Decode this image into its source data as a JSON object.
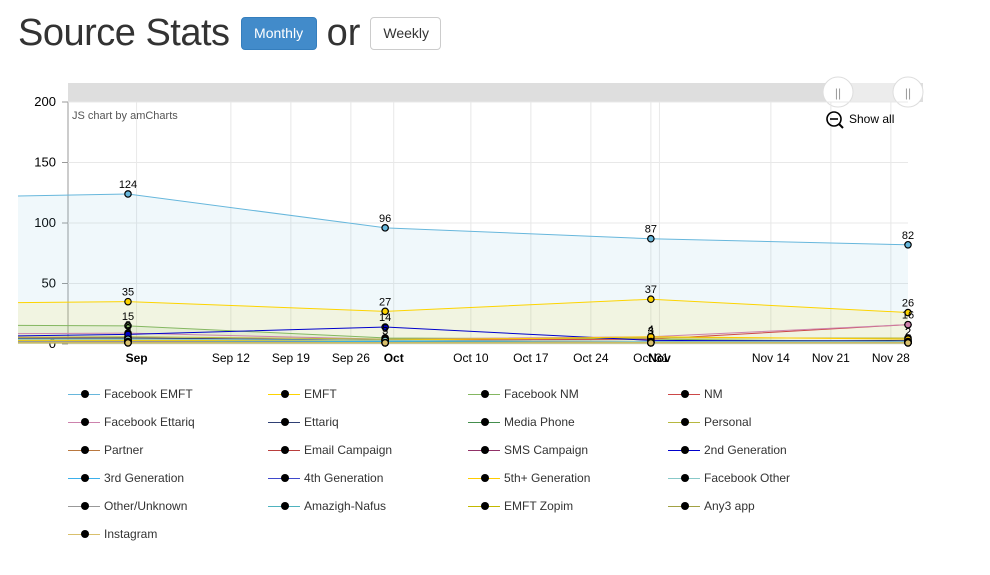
{
  "page": {
    "title": "Source Stats",
    "or_text": "or",
    "monthly_label": "Monthly",
    "weekly_label": "Weekly"
  },
  "chart_ui": {
    "credit": "JS chart by amCharts",
    "show_all": "Show all",
    "scroll_handle_glyph": "||"
  },
  "colors": {
    "primary_button": "#428bca",
    "grid": "#e8e8e8",
    "scrollbar": "#dedede"
  },
  "chart_data": {
    "type": "line",
    "ylim": [
      0,
      200
    ],
    "yticks": [
      0,
      50,
      100,
      150,
      200
    ],
    "xlim": [
      "2015-08-24",
      "2015-11-30"
    ],
    "xticks": [
      {
        "date": "2015-09-01",
        "label": "Sep",
        "bold": true
      },
      {
        "date": "2015-09-12",
        "label": "Sep 12"
      },
      {
        "date": "2015-09-19",
        "label": "Sep 19"
      },
      {
        "date": "2015-09-26",
        "label": "Sep 26"
      },
      {
        "date": "2015-10-01",
        "label": "Oct",
        "bold": true
      },
      {
        "date": "2015-10-10",
        "label": "Oct 10"
      },
      {
        "date": "2015-10-17",
        "label": "Oct 17"
      },
      {
        "date": "2015-10-24",
        "label": "Oct 24"
      },
      {
        "date": "2015-10-31",
        "label": "Oct 31"
      },
      {
        "date": "2015-11-01",
        "label": "Nov",
        "bold": true
      },
      {
        "date": "2015-11-14",
        "label": "Nov 14"
      },
      {
        "date": "2015-11-21",
        "label": "Nov 21"
      },
      {
        "date": "2015-11-28",
        "label": "Nov 28"
      }
    ],
    "x": [
      "2015-08-01",
      "2015-08-31",
      "2015-09-30",
      "2015-10-31",
      "2015-11-30"
    ],
    "grid": true,
    "legend_position": "bottom",
    "series": [
      {
        "name": "Facebook EMFT",
        "color": "#67b7dc",
        "fill": true,
        "values": [
          120,
          124,
          96,
          87,
          82
        ],
        "labels": true
      },
      {
        "name": "EMFT",
        "color": "#fdd400",
        "fill": true,
        "values": [
          33,
          35,
          27,
          37,
          26
        ],
        "labels": true
      },
      {
        "name": "Facebook NM",
        "color": "#84b761",
        "fill": true,
        "values": [
          16,
          15,
          5,
          4,
          2
        ],
        "labels": true
      },
      {
        "name": "NM",
        "color": "#cc4748",
        "values": [
          6,
          5,
          3,
          4,
          16
        ],
        "labels": true
      },
      {
        "name": "Facebook Ettariq",
        "color": "#cd82ad",
        "values": [
          8,
          9,
          4,
          6,
          16
        ]
      },
      {
        "name": "Ettariq",
        "color": "#2f4074",
        "values": [
          4,
          5,
          3,
          2,
          3
        ]
      },
      {
        "name": "Media Phone",
        "color": "#448e4d",
        "values": [
          3,
          3,
          2,
          2,
          2
        ]
      },
      {
        "name": "Personal",
        "color": "#b7b83f",
        "values": [
          5,
          6,
          4,
          5,
          5
        ]
      },
      {
        "name": "Partner",
        "color": "#b9783f",
        "values": [
          2,
          2,
          1,
          2,
          2
        ]
      },
      {
        "name": "Email Campaign",
        "color": "#b93e3d",
        "values": [
          1,
          1,
          1,
          1,
          1
        ]
      },
      {
        "name": "SMS Campaign",
        "color": "#913167",
        "values": [
          1,
          1,
          1,
          1,
          1
        ]
      },
      {
        "name": "2nd Generation",
        "color": "#0000cc",
        "values": [
          5,
          8,
          14,
          3,
          2
        ],
        "labels": true
      },
      {
        "name": "3rd Generation",
        "color": "#3bb0ec",
        "values": [
          2,
          3,
          2,
          1,
          1
        ]
      },
      {
        "name": "4th Generation",
        "color": "#3f49cc",
        "values": [
          1,
          2,
          1,
          1,
          1
        ]
      },
      {
        "name": "5th+ Generation",
        "color": "#ffcc00",
        "values": [
          3,
          3,
          3,
          6,
          4
        ]
      },
      {
        "name": "Facebook Other",
        "color": "#88c9c9",
        "values": [
          4,
          4,
          3,
          2,
          2
        ]
      },
      {
        "name": "Other/Unknown",
        "color": "#999999",
        "values": [
          2,
          2,
          1,
          1,
          1
        ]
      },
      {
        "name": "Amazigh-Nafus",
        "color": "#4fb3bf",
        "values": [
          1,
          1,
          1,
          1,
          1
        ]
      },
      {
        "name": "EMFT Zopim",
        "color": "#c3b900",
        "values": [
          1,
          1,
          1,
          1,
          1
        ]
      },
      {
        "name": "Any3 app",
        "color": "#a2a244",
        "values": [
          1,
          1,
          1,
          1,
          1
        ]
      },
      {
        "name": "Instagram",
        "color": "#d9c06c",
        "values": [
          1,
          1,
          1,
          1,
          1
        ]
      }
    ]
  }
}
